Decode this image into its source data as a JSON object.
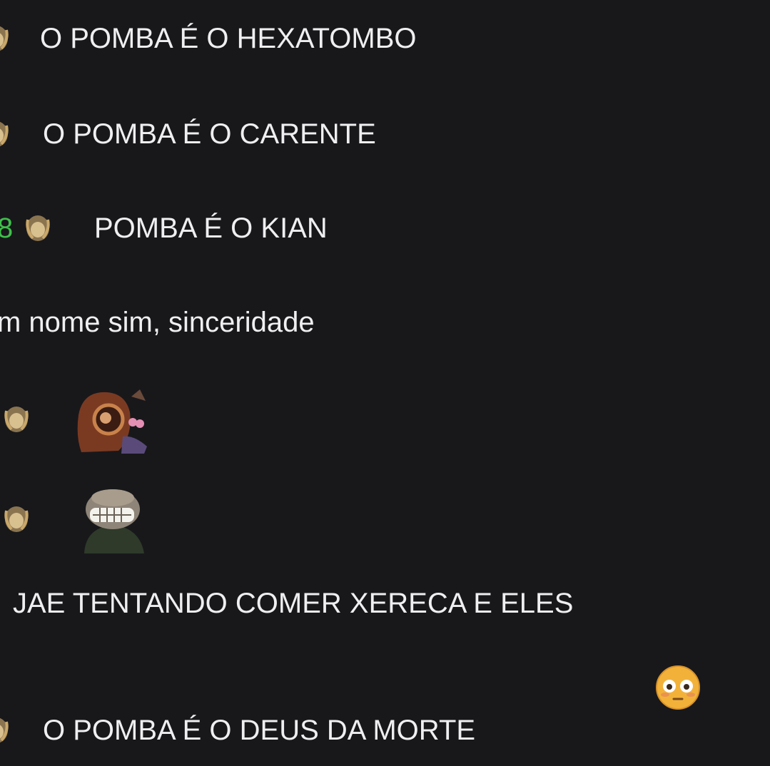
{
  "chat": {
    "messages": [
      {
        "text": "O POMBA É O HEXATOMBO"
      },
      {
        "text": "O POMBA É O CARENTE"
      },
      {
        "username_fragment": "8",
        "text": "POMBA É O KIAN"
      },
      {
        "text": "m nome sim, sinceridade"
      },
      {
        "emote": "brown-creature-emote"
      },
      {
        "emote": "grinning-hooded-figure-emote"
      },
      {
        "text": "JAE TENTANDO COMER XERECA E ELES"
      },
      {
        "reaction": "flushed-face-emoji"
      },
      {
        "text": "O POMBA É O DEUS DA MORTE"
      }
    ]
  },
  "colors": {
    "background": "#18181b",
    "text": "#efeff1",
    "username_green": "#3fbf4a",
    "badge_gold": "#c9a86a"
  }
}
